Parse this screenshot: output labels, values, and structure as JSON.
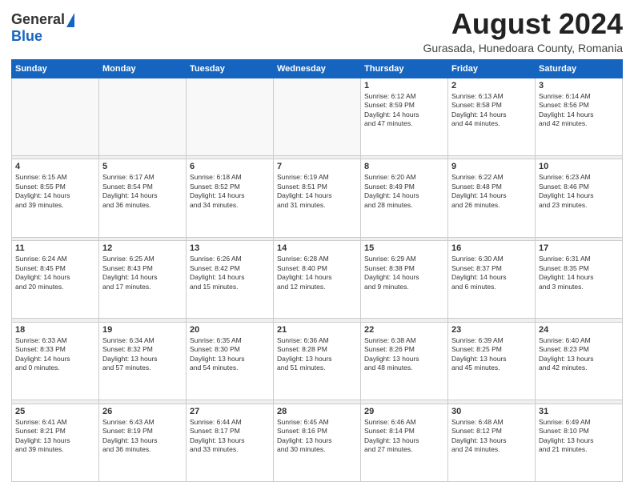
{
  "logo": {
    "general": "General",
    "blue": "Blue"
  },
  "header": {
    "month": "August 2024",
    "location": "Gurasada, Hunedoara County, Romania"
  },
  "days_header": [
    "Sunday",
    "Monday",
    "Tuesday",
    "Wednesday",
    "Thursday",
    "Friday",
    "Saturday"
  ],
  "weeks": [
    [
      {
        "day": "",
        "info": ""
      },
      {
        "day": "",
        "info": ""
      },
      {
        "day": "",
        "info": ""
      },
      {
        "day": "",
        "info": ""
      },
      {
        "day": "1",
        "info": "Sunrise: 6:12 AM\nSunset: 8:59 PM\nDaylight: 14 hours\nand 47 minutes."
      },
      {
        "day": "2",
        "info": "Sunrise: 6:13 AM\nSunset: 8:58 PM\nDaylight: 14 hours\nand 44 minutes."
      },
      {
        "day": "3",
        "info": "Sunrise: 6:14 AM\nSunset: 8:56 PM\nDaylight: 14 hours\nand 42 minutes."
      }
    ],
    [
      {
        "day": "4",
        "info": "Sunrise: 6:15 AM\nSunset: 8:55 PM\nDaylight: 14 hours\nand 39 minutes."
      },
      {
        "day": "5",
        "info": "Sunrise: 6:17 AM\nSunset: 8:54 PM\nDaylight: 14 hours\nand 36 minutes."
      },
      {
        "day": "6",
        "info": "Sunrise: 6:18 AM\nSunset: 8:52 PM\nDaylight: 14 hours\nand 34 minutes."
      },
      {
        "day": "7",
        "info": "Sunrise: 6:19 AM\nSunset: 8:51 PM\nDaylight: 14 hours\nand 31 minutes."
      },
      {
        "day": "8",
        "info": "Sunrise: 6:20 AM\nSunset: 8:49 PM\nDaylight: 14 hours\nand 28 minutes."
      },
      {
        "day": "9",
        "info": "Sunrise: 6:22 AM\nSunset: 8:48 PM\nDaylight: 14 hours\nand 26 minutes."
      },
      {
        "day": "10",
        "info": "Sunrise: 6:23 AM\nSunset: 8:46 PM\nDaylight: 14 hours\nand 23 minutes."
      }
    ],
    [
      {
        "day": "11",
        "info": "Sunrise: 6:24 AM\nSunset: 8:45 PM\nDaylight: 14 hours\nand 20 minutes."
      },
      {
        "day": "12",
        "info": "Sunrise: 6:25 AM\nSunset: 8:43 PM\nDaylight: 14 hours\nand 17 minutes."
      },
      {
        "day": "13",
        "info": "Sunrise: 6:26 AM\nSunset: 8:42 PM\nDaylight: 14 hours\nand 15 minutes."
      },
      {
        "day": "14",
        "info": "Sunrise: 6:28 AM\nSunset: 8:40 PM\nDaylight: 14 hours\nand 12 minutes."
      },
      {
        "day": "15",
        "info": "Sunrise: 6:29 AM\nSunset: 8:38 PM\nDaylight: 14 hours\nand 9 minutes."
      },
      {
        "day": "16",
        "info": "Sunrise: 6:30 AM\nSunset: 8:37 PM\nDaylight: 14 hours\nand 6 minutes."
      },
      {
        "day": "17",
        "info": "Sunrise: 6:31 AM\nSunset: 8:35 PM\nDaylight: 14 hours\nand 3 minutes."
      }
    ],
    [
      {
        "day": "18",
        "info": "Sunrise: 6:33 AM\nSunset: 8:33 PM\nDaylight: 14 hours\nand 0 minutes."
      },
      {
        "day": "19",
        "info": "Sunrise: 6:34 AM\nSunset: 8:32 PM\nDaylight: 13 hours\nand 57 minutes."
      },
      {
        "day": "20",
        "info": "Sunrise: 6:35 AM\nSunset: 8:30 PM\nDaylight: 13 hours\nand 54 minutes."
      },
      {
        "day": "21",
        "info": "Sunrise: 6:36 AM\nSunset: 8:28 PM\nDaylight: 13 hours\nand 51 minutes."
      },
      {
        "day": "22",
        "info": "Sunrise: 6:38 AM\nSunset: 8:26 PM\nDaylight: 13 hours\nand 48 minutes."
      },
      {
        "day": "23",
        "info": "Sunrise: 6:39 AM\nSunset: 8:25 PM\nDaylight: 13 hours\nand 45 minutes."
      },
      {
        "day": "24",
        "info": "Sunrise: 6:40 AM\nSunset: 8:23 PM\nDaylight: 13 hours\nand 42 minutes."
      }
    ],
    [
      {
        "day": "25",
        "info": "Sunrise: 6:41 AM\nSunset: 8:21 PM\nDaylight: 13 hours\nand 39 minutes."
      },
      {
        "day": "26",
        "info": "Sunrise: 6:43 AM\nSunset: 8:19 PM\nDaylight: 13 hours\nand 36 minutes."
      },
      {
        "day": "27",
        "info": "Sunrise: 6:44 AM\nSunset: 8:17 PM\nDaylight: 13 hours\nand 33 minutes."
      },
      {
        "day": "28",
        "info": "Sunrise: 6:45 AM\nSunset: 8:16 PM\nDaylight: 13 hours\nand 30 minutes."
      },
      {
        "day": "29",
        "info": "Sunrise: 6:46 AM\nSunset: 8:14 PM\nDaylight: 13 hours\nand 27 minutes."
      },
      {
        "day": "30",
        "info": "Sunrise: 6:48 AM\nSunset: 8:12 PM\nDaylight: 13 hours\nand 24 minutes."
      },
      {
        "day": "31",
        "info": "Sunrise: 6:49 AM\nSunset: 8:10 PM\nDaylight: 13 hours\nand 21 minutes."
      }
    ]
  ]
}
